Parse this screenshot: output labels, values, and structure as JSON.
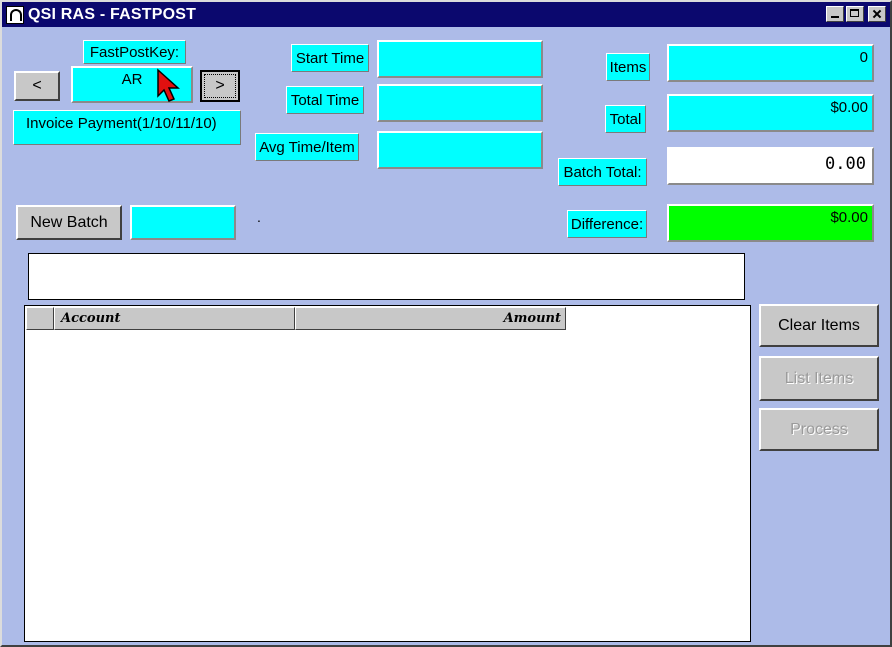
{
  "window": {
    "title": "QSI RAS - FASTPOST"
  },
  "fastpost": {
    "key_label": "FastPostKey:",
    "key_value": "AR",
    "prev_label": "<",
    "next_label": ">",
    "description": "Invoice Payment(1/10/11/10)"
  },
  "timing": {
    "start_label": "Start Time",
    "start_value": "",
    "total_label": "Total Time",
    "total_value": "",
    "avg_label": "Avg Time/Item",
    "avg_value": ""
  },
  "summary": {
    "items_label": "Items",
    "items_value": "0",
    "total_label": "Total",
    "total_value": "$0.00",
    "batch_total_label": "Batch Total:",
    "batch_total_value": "0.00",
    "difference_label": "Difference:",
    "difference_value": "$0.00"
  },
  "batch": {
    "new_batch_label": "New Batch",
    "batch_field": "",
    "dot": "."
  },
  "grid": {
    "columns": [
      "",
      "Account",
      "Amount"
    ],
    "rows": []
  },
  "actions": {
    "clear_items": "Clear Items",
    "list_items": "List Items",
    "process": "Process"
  },
  "colors": {
    "field": "#00ffff",
    "difference_ok": "#00ff00",
    "background": "#adbbe8",
    "titlebar": "#0b086e"
  }
}
